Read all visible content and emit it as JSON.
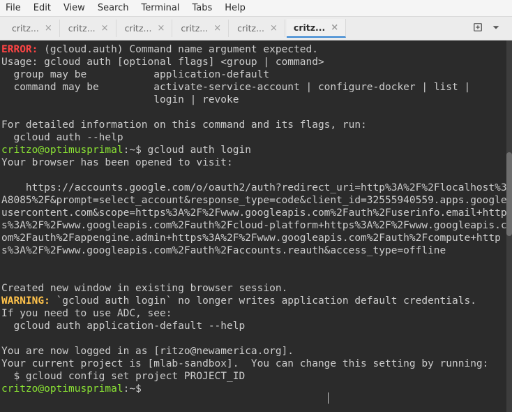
{
  "menubar": {
    "items": [
      "File",
      "Edit",
      "View",
      "Search",
      "Terminal",
      "Tabs",
      "Help"
    ]
  },
  "tabs": {
    "items": [
      {
        "label": "critz...",
        "active": false
      },
      {
        "label": "critz...",
        "active": false
      },
      {
        "label": "critz...",
        "active": false
      },
      {
        "label": "critz...",
        "active": false
      },
      {
        "label": "critz...",
        "active": false
      },
      {
        "label": "critz...",
        "active": true
      }
    ]
  },
  "terminal": {
    "error_label": "ERROR:",
    "error_text": " (gcloud.auth) Command name argument expected.",
    "usage": "Usage: gcloud auth [optional flags] <group | command>\n  group may be           application-default\n  command may be         activate-service-account | configure-docker | list |\n                         login | revoke\n\nFor detailed information on this command and its flags, run:\n  gcloud auth --help",
    "prompt1_user": "critzo@optimusprimal",
    "prompt1_sep": ":",
    "prompt1_path": "~",
    "prompt1_cmd": "$ gcloud auth login",
    "browser_opened": "Your browser has been opened to visit:\n\n    https://accounts.google.com/o/oauth2/auth?redirect_uri=http%3A%2F%2Flocalhost%3A8085%2F&prompt=select_account&response_type=code&client_id=32555940559.apps.googleusercontent.com&scope=https%3A%2F%2Fwww.googleapis.com%2Fauth%2Fuserinfo.email+https%3A%2F%2Fwww.googleapis.com%2Fauth%2Fcloud-platform+https%3A%2F%2Fwww.googleapis.com%2Fauth%2Fappengine.admin+https%3A%2F%2Fwww.googleapis.com%2Fauth%2Fcompute+https%3A%2F%2Fwww.googleapis.com%2Fauth%2Faccounts.reauth&access_type=offline\n\n\nCreated new window in existing browser session.",
    "warning_label": "WARNING:",
    "warning_text": " `gcloud auth login` no longer writes application default credentials.",
    "adc_text": "If you need to use ADC, see:\n  gcloud auth application-default --help\n\nYou are now logged in as [ritzo@newamerica.org].\nYour current project is [mlab-sandbox].  You can change this setting by running:\n  $ gcloud config set project PROJECT_ID",
    "prompt2_user": "critzo@optimusprimal",
    "prompt2_sep": ":",
    "prompt2_path": "~",
    "prompt2_cmd": "$ "
  }
}
